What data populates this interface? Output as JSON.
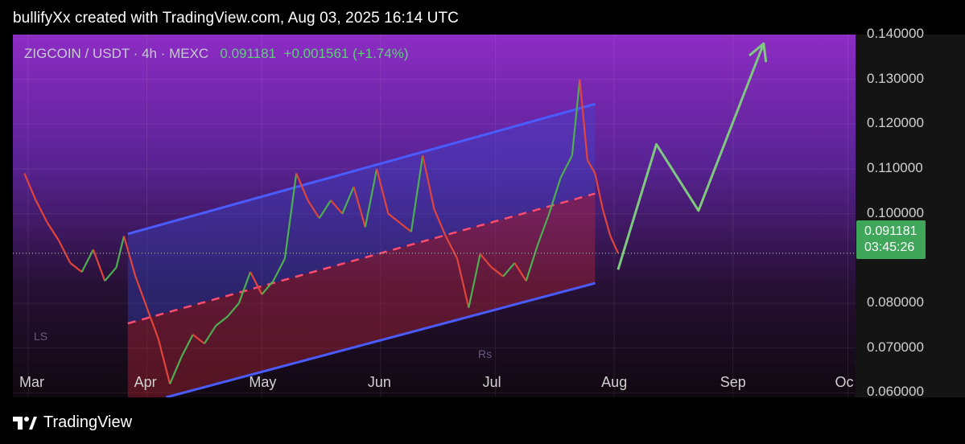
{
  "header": {
    "credit": "bullifyXx created with TradingView.com, Aug 03, 2025 16:14 UTC"
  },
  "symbol_bar": {
    "symbol": "ZIGCOIN / USDT · 4h · MEXC",
    "last": "0.091181",
    "change": "+0.001561 (+1.74%)"
  },
  "price_badge": {
    "price": "0.091181",
    "countdown": "03:45:26"
  },
  "watermarks": {
    "left": "LS",
    "right": "Rs"
  },
  "footer": {
    "brand": "TradingView"
  },
  "colors": {
    "up": "#4caf50",
    "down": "#e0443a",
    "channel_line": "#4a5cff",
    "mid_line": "#ff4d6d",
    "projection": "#7fc97f",
    "badge": "#3fa65a"
  },
  "chart_data": {
    "type": "line",
    "title": "",
    "xlabel": "",
    "ylabel": "",
    "x_ticks": [
      "Mar",
      "Apr",
      "May",
      "Jun",
      "Jul",
      "Aug",
      "Sep",
      "Oc"
    ],
    "y_ticks": [
      "0.060000",
      "0.070000",
      "0.080000",
      "0.100000",
      "0.110000",
      "0.120000",
      "0.130000",
      "0.140000"
    ],
    "ylim": [
      0.059,
      0.14
    ],
    "grid": true,
    "series": [
      {
        "type": "price",
        "points": [
          [
            "Feb 28",
            0.109
          ],
          [
            "Mar 03",
            0.103
          ],
          [
            "Mar 06",
            0.098
          ],
          [
            "Mar 09",
            0.094
          ],
          [
            "Mar 12",
            0.089
          ],
          [
            "Mar 15",
            0.087
          ],
          [
            "Mar 18",
            0.092
          ],
          [
            "Mar 21",
            0.085
          ],
          [
            "Mar 24",
            0.088
          ],
          [
            "Mar 26",
            0.095
          ],
          [
            "Mar 29",
            0.086
          ],
          [
            "Apr 01",
            0.079
          ],
          [
            "Apr 04",
            0.072
          ],
          [
            "Apr 07",
            0.062
          ],
          [
            "Apr 10",
            0.068
          ],
          [
            "Apr 13",
            0.073
          ],
          [
            "Apr 16",
            0.071
          ],
          [
            "Apr 19",
            0.075
          ],
          [
            "Apr 22",
            0.077
          ],
          [
            "Apr 25",
            0.08
          ],
          [
            "Apr 28",
            0.087
          ],
          [
            "May 01",
            0.082
          ],
          [
            "May 04",
            0.085
          ],
          [
            "May 07",
            0.09
          ],
          [
            "May 10",
            0.109
          ],
          [
            "May 13",
            0.103
          ],
          [
            "May 16",
            0.099
          ],
          [
            "May 19",
            0.103
          ],
          [
            "May 22",
            0.1
          ],
          [
            "May 25",
            0.106
          ],
          [
            "May 28",
            0.097
          ],
          [
            "May 31",
            0.11
          ],
          [
            "Jun 03",
            0.1
          ],
          [
            "Jun 06",
            0.098
          ],
          [
            "Jun 09",
            0.096
          ],
          [
            "Jun 12",
            0.113
          ],
          [
            "Jun 15",
            0.101
          ],
          [
            "Jun 18",
            0.095
          ],
          [
            "Jun 21",
            0.09
          ],
          [
            "Jun 24",
            0.079
          ],
          [
            "Jun 27",
            0.091
          ],
          [
            "Jun 30",
            0.088
          ],
          [
            "Jul 03",
            0.086
          ],
          [
            "Jul 06",
            0.089
          ],
          [
            "Jul 09",
            0.085
          ],
          [
            "Jul 12",
            0.093
          ],
          [
            "Jul 15",
            0.1
          ],
          [
            "Jul 18",
            0.108
          ],
          [
            "Jul 21",
            0.113
          ],
          [
            "Jul 23",
            0.13
          ],
          [
            "Jul 25",
            0.112
          ],
          [
            "Jul 27",
            0.109
          ],
          [
            "Jul 29",
            0.101
          ],
          [
            "Jul 31",
            0.095
          ],
          [
            "Aug 02",
            0.0912
          ]
        ]
      },
      {
        "type": "channel_upper",
        "points": [
          [
            "Mar 27",
            0.0955
          ],
          [
            "Jul 27",
            0.1245
          ]
        ]
      },
      {
        "type": "channel_lower",
        "points": [
          [
            "Apr 06",
            0.059
          ],
          [
            "Jul 27",
            0.0845
          ]
        ]
      },
      {
        "type": "channel_mid",
        "points": [
          [
            "Mar 27",
            0.0755
          ],
          [
            "Jul 27",
            0.1045
          ]
        ]
      },
      {
        "type": "projection",
        "points": [
          [
            "Aug 02",
            0.0875
          ],
          [
            "Aug 12",
            0.1155
          ],
          [
            "Aug 23",
            0.1007
          ],
          [
            "Sep 09",
            0.138
          ]
        ]
      }
    ]
  }
}
